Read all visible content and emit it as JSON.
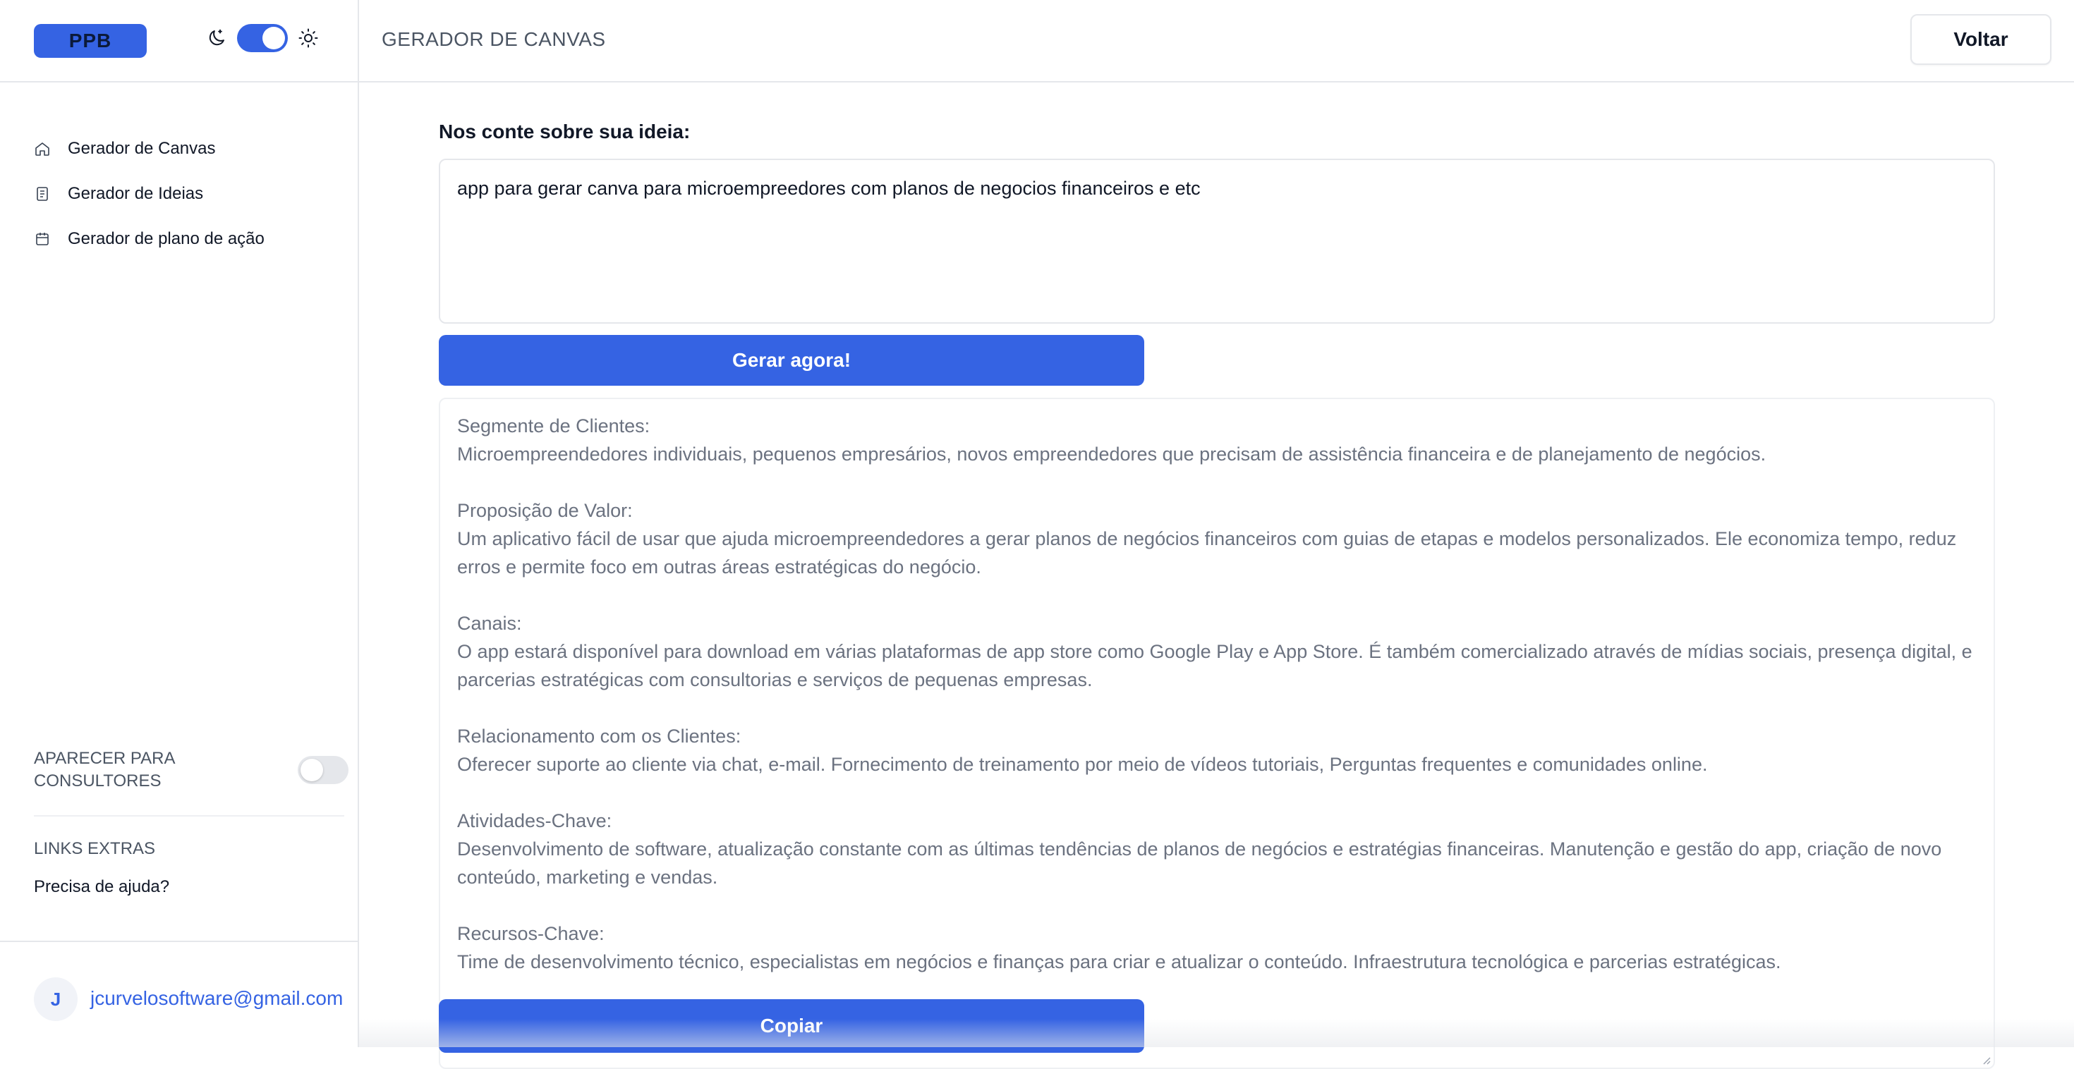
{
  "sidebar": {
    "logo": "PPB",
    "nav": [
      {
        "label": "Gerador de Canvas",
        "icon": "home-icon"
      },
      {
        "label": "Gerador de Ideias",
        "icon": "document-icon"
      },
      {
        "label": "Gerador de plano de ação",
        "icon": "calendar-icon"
      }
    ],
    "consultants_label": "APARECER PARA CONSULTORES",
    "consultants_toggle": false,
    "extras_title": "LINKS EXTRAS",
    "help_link": "Precisa de ajuda?",
    "user": {
      "initial": "J",
      "email": "jcurvelosoftware@gmail.com"
    }
  },
  "theme": {
    "dark_mode_on": true,
    "accent": "#3563e3"
  },
  "header": {
    "title": "GERADOR DE CANVAS",
    "back_label": "Voltar"
  },
  "main": {
    "idea_label": "Nos conte sobre sua ideia:",
    "idea_value": "app para gerar canva para microempreedores com planos de negocios financeiros e etc",
    "generate_label": "Gerar agora!",
    "copy_label": "Copiar",
    "result_sections": [
      {
        "heading": "Segmente de Clientes:",
        "body": "Microempreendedores individuais, pequenos empresários, novos empreendedores que precisam de assistência financeira e de planejamento de negócios."
      },
      {
        "heading": "Proposição de Valor:",
        "body": "Um aplicativo fácil de usar que ajuda microempreendedores a gerar planos de negócios financeiros com guias de etapas e modelos personalizados. Ele economiza tempo, reduz erros e permite foco em outras áreas estratégicas do negócio."
      },
      {
        "heading": "Canais:",
        "body": "O app estará disponível para download em várias plataformas de app store como Google Play e App Store. É também comercializado através de mídias sociais, presença digital, e parcerias estratégicas com consultorias e serviços de pequenas empresas."
      },
      {
        "heading": "Relacionamento com os Clientes:",
        "body": "Oferecer suporte ao cliente via chat, e-mail. Fornecimento de treinamento por meio de vídeos tutoriais, Perguntas frequentes e comunidades online."
      },
      {
        "heading": "Atividades-Chave:",
        "body": "Desenvolvimento de software, atualização constante com as últimas tendências de planos de negócios e estratégias financeiras. Manutenção e gestão do app, criação de novo conteúdo, marketing e vendas."
      },
      {
        "heading": "Recursos-Chave:",
        "body": "Time de desenvolvimento técnico, especialistas em negócios e finanças para criar e atualizar o conteúdo. Infraestrutura tecnológica e parcerias estratégicas."
      }
    ]
  }
}
